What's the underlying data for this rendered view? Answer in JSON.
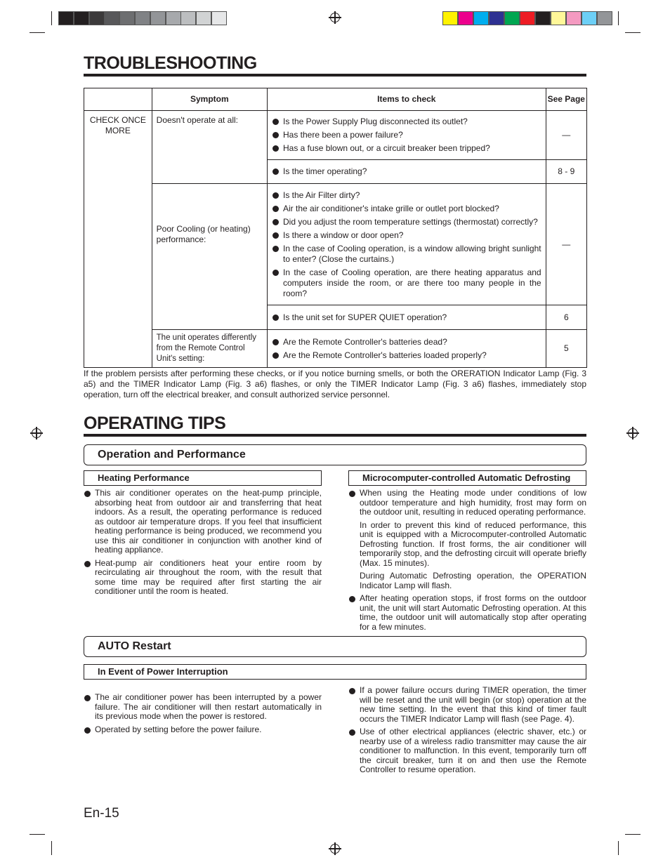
{
  "print_marks": {
    "gray_swatches": [
      "#231f20",
      "#231f20",
      "#3c3a3b",
      "#58585a",
      "#6d6e70",
      "#808285",
      "#939598",
      "#a7a9ac",
      "#bcbec0",
      "#d1d3d4",
      "#e6e7e8"
    ],
    "color_swatches": [
      "#fff200",
      "#ec008c",
      "#00aeef",
      "#2e3192",
      "#00a651",
      "#ed1c24",
      "#231f20",
      "#fff799",
      "#f49ac1",
      "#6dcff6",
      "#939598"
    ]
  },
  "troubleshooting": {
    "title": "TROUBLESHOOTING",
    "headers": [
      "",
      "Symptom",
      "Items to check",
      "See Page"
    ],
    "category": "CHECK ONCE MORE",
    "groups": [
      {
        "symptom": "Doesn't operate at all:",
        "rows": [
          {
            "items": [
              "Is the Power Supply Plug disconnected its outlet?",
              "Has there been a power failure?",
              "Has a fuse blown out, or a circuit breaker been tripped?"
            ],
            "page": "—"
          },
          {
            "items": [
              "Is the timer operating?"
            ],
            "page": "8 - 9"
          }
        ]
      },
      {
        "symptom": "Poor Cooling (or heating) performance:",
        "rows": [
          {
            "items": [
              "Is the Air Filter dirty?",
              "Air the air conditioner's intake grille or outlet port blocked?",
              "Did you adjust the room temperature settings (thermostat) correctly?",
              "Is there a window or door open?",
              "In the case of Cooling operation, is a window allowing bright sunlight to enter? (Close the curtains.)",
              "In the case of Cooling operation, are there heating apparatus and computers inside the room, or are there too many people in the room?"
            ],
            "page": "—"
          },
          {
            "items": [
              "Is the unit set for SUPER QUIET operation?"
            ],
            "page": "6"
          }
        ]
      },
      {
        "symptom": "The unit operates differently from the Remote Control Unit's setting:",
        "rows": [
          {
            "items": [
              "Are the Remote Controller's batteries dead?",
              "Are the Remote Controller's batteries loaded properly?"
            ],
            "page": "5"
          }
        ]
      }
    ],
    "note": "If the problem persists after performing these checks, or if you notice burning smells, or both the ORERATION Indicator Lamp (Fig. 3 a5) and the TIMER Indicator Lamp (Fig. 3 a6) flashes, or only the TIMER Indicator Lamp (Fig. 3 a6) flashes, immediately stop operation, turn off the electrical breaker, and consult authorized service personnel."
  },
  "operating_tips": {
    "title": "OPERATING TIPS",
    "section1": {
      "title": "Operation and Performance",
      "left": {
        "title": "Heating Performance",
        "items": [
          "This air conditioner operates on the heat-pump principle, absorbing heat from outdoor air and transferring that heat indoors. As a result, the operating performance is reduced as outdoor air temperature drops. If you feel that insufficient heating performance is being produced, we recommend you use this air conditioner in conjunction with another kind of heating appliance.",
          "Heat-pump air conditioners heat your entire room by recirculating air throughout the room, with the result that some time may be required after first starting the air conditioner until the room is heated."
        ]
      },
      "right": {
        "title": "Microcomputer-controlled Automatic Defrosting",
        "item1": "When using the Heating mode under conditions of low outdoor temperature and high humidity, frost may form on the outdoor unit, resulting in reduced operating performance.",
        "para1": "In order to prevent this kind of reduced performance, this unit is equipped with a Microcomputer-controlled Automatic Defrosting function. If frost forms, the air conditioner will temporarily stop, and the defrosting circuit will operate briefly (Max. 15 minutes).",
        "para2": "During Automatic Defrosting operation, the OPERATION Indicator Lamp will flash.",
        "item2": "After heating operation stops, if frost forms on the outdoor unit, the unit will start Automatic Defrosting operation. At this time, the outdoor unit will automatically stop after operating for a few minutes."
      }
    },
    "section2": {
      "title": "AUTO Restart",
      "subtitle": "In Event of Power Interruption",
      "left": [
        "The air conditioner power has been interrupted by a power failure. The air conditioner will then restart automatically in its previous mode when the power is restored.",
        "Operated by setting before the power failure."
      ],
      "right": [
        "If a power failure occurs during TIMER operation, the timer will be reset and the unit will begin (or stop) operation at the new time setting. In the event that this kind of timer fault occurs the TIMER Indicator Lamp will flash (see Page. 4).",
        "Use of other electrical appliances (electric shaver, etc.) or nearby use of a wireless radio transmitter may cause the air conditioner to malfunction. In this event, temporarily turn off the circuit breaker, turn it on and then use the Remote Controller to resume operation."
      ]
    }
  },
  "page_number": "En-15"
}
